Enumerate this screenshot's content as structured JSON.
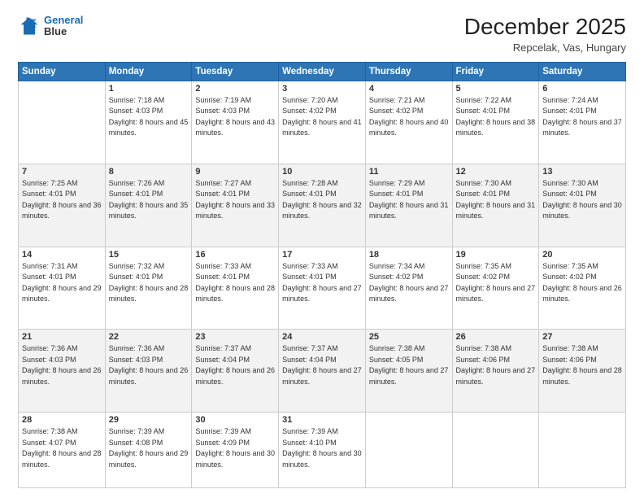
{
  "logo": {
    "line1": "General",
    "line2": "Blue"
  },
  "header": {
    "month": "December 2025",
    "location": "Repcelak, Vas, Hungary"
  },
  "weekdays": [
    "Sunday",
    "Monday",
    "Tuesday",
    "Wednesday",
    "Thursday",
    "Friday",
    "Saturday"
  ],
  "weeks": [
    [
      {
        "day": "",
        "sunrise": "",
        "sunset": "",
        "daylight": ""
      },
      {
        "day": "1",
        "sunrise": "Sunrise: 7:18 AM",
        "sunset": "Sunset: 4:03 PM",
        "daylight": "Daylight: 8 hours and 45 minutes."
      },
      {
        "day": "2",
        "sunrise": "Sunrise: 7:19 AM",
        "sunset": "Sunset: 4:03 PM",
        "daylight": "Daylight: 8 hours and 43 minutes."
      },
      {
        "day": "3",
        "sunrise": "Sunrise: 7:20 AM",
        "sunset": "Sunset: 4:02 PM",
        "daylight": "Daylight: 8 hours and 41 minutes."
      },
      {
        "day": "4",
        "sunrise": "Sunrise: 7:21 AM",
        "sunset": "Sunset: 4:02 PM",
        "daylight": "Daylight: 8 hours and 40 minutes."
      },
      {
        "day": "5",
        "sunrise": "Sunrise: 7:22 AM",
        "sunset": "Sunset: 4:01 PM",
        "daylight": "Daylight: 8 hours and 38 minutes."
      },
      {
        "day": "6",
        "sunrise": "Sunrise: 7:24 AM",
        "sunset": "Sunset: 4:01 PM",
        "daylight": "Daylight: 8 hours and 37 minutes."
      }
    ],
    [
      {
        "day": "7",
        "sunrise": "Sunrise: 7:25 AM",
        "sunset": "Sunset: 4:01 PM",
        "daylight": "Daylight: 8 hours and 36 minutes."
      },
      {
        "day": "8",
        "sunrise": "Sunrise: 7:26 AM",
        "sunset": "Sunset: 4:01 PM",
        "daylight": "Daylight: 8 hours and 35 minutes."
      },
      {
        "day": "9",
        "sunrise": "Sunrise: 7:27 AM",
        "sunset": "Sunset: 4:01 PM",
        "daylight": "Daylight: 8 hours and 33 minutes."
      },
      {
        "day": "10",
        "sunrise": "Sunrise: 7:28 AM",
        "sunset": "Sunset: 4:01 PM",
        "daylight": "Daylight: 8 hours and 32 minutes."
      },
      {
        "day": "11",
        "sunrise": "Sunrise: 7:29 AM",
        "sunset": "Sunset: 4:01 PM",
        "daylight": "Daylight: 8 hours and 31 minutes."
      },
      {
        "day": "12",
        "sunrise": "Sunrise: 7:30 AM",
        "sunset": "Sunset: 4:01 PM",
        "daylight": "Daylight: 8 hours and 31 minutes."
      },
      {
        "day": "13",
        "sunrise": "Sunrise: 7:30 AM",
        "sunset": "Sunset: 4:01 PM",
        "daylight": "Daylight: 8 hours and 30 minutes."
      }
    ],
    [
      {
        "day": "14",
        "sunrise": "Sunrise: 7:31 AM",
        "sunset": "Sunset: 4:01 PM",
        "daylight": "Daylight: 8 hours and 29 minutes."
      },
      {
        "day": "15",
        "sunrise": "Sunrise: 7:32 AM",
        "sunset": "Sunset: 4:01 PM",
        "daylight": "Daylight: 8 hours and 28 minutes."
      },
      {
        "day": "16",
        "sunrise": "Sunrise: 7:33 AM",
        "sunset": "Sunset: 4:01 PM",
        "daylight": "Daylight: 8 hours and 28 minutes."
      },
      {
        "day": "17",
        "sunrise": "Sunrise: 7:33 AM",
        "sunset": "Sunset: 4:01 PM",
        "daylight": "Daylight: 8 hours and 27 minutes."
      },
      {
        "day": "18",
        "sunrise": "Sunrise: 7:34 AM",
        "sunset": "Sunset: 4:02 PM",
        "daylight": "Daylight: 8 hours and 27 minutes."
      },
      {
        "day": "19",
        "sunrise": "Sunrise: 7:35 AM",
        "sunset": "Sunset: 4:02 PM",
        "daylight": "Daylight: 8 hours and 27 minutes."
      },
      {
        "day": "20",
        "sunrise": "Sunrise: 7:35 AM",
        "sunset": "Sunset: 4:02 PM",
        "daylight": "Daylight: 8 hours and 26 minutes."
      }
    ],
    [
      {
        "day": "21",
        "sunrise": "Sunrise: 7:36 AM",
        "sunset": "Sunset: 4:03 PM",
        "daylight": "Daylight: 8 hours and 26 minutes."
      },
      {
        "day": "22",
        "sunrise": "Sunrise: 7:36 AM",
        "sunset": "Sunset: 4:03 PM",
        "daylight": "Daylight: 8 hours and 26 minutes."
      },
      {
        "day": "23",
        "sunrise": "Sunrise: 7:37 AM",
        "sunset": "Sunset: 4:04 PM",
        "daylight": "Daylight: 8 hours and 26 minutes."
      },
      {
        "day": "24",
        "sunrise": "Sunrise: 7:37 AM",
        "sunset": "Sunset: 4:04 PM",
        "daylight": "Daylight: 8 hours and 27 minutes."
      },
      {
        "day": "25",
        "sunrise": "Sunrise: 7:38 AM",
        "sunset": "Sunset: 4:05 PM",
        "daylight": "Daylight: 8 hours and 27 minutes."
      },
      {
        "day": "26",
        "sunrise": "Sunrise: 7:38 AM",
        "sunset": "Sunset: 4:06 PM",
        "daylight": "Daylight: 8 hours and 27 minutes."
      },
      {
        "day": "27",
        "sunrise": "Sunrise: 7:38 AM",
        "sunset": "Sunset: 4:06 PM",
        "daylight": "Daylight: 8 hours and 28 minutes."
      }
    ],
    [
      {
        "day": "28",
        "sunrise": "Sunrise: 7:38 AM",
        "sunset": "Sunset: 4:07 PM",
        "daylight": "Daylight: 8 hours and 28 minutes."
      },
      {
        "day": "29",
        "sunrise": "Sunrise: 7:39 AM",
        "sunset": "Sunset: 4:08 PM",
        "daylight": "Daylight: 8 hours and 29 minutes."
      },
      {
        "day": "30",
        "sunrise": "Sunrise: 7:39 AM",
        "sunset": "Sunset: 4:09 PM",
        "daylight": "Daylight: 8 hours and 30 minutes."
      },
      {
        "day": "31",
        "sunrise": "Sunrise: 7:39 AM",
        "sunset": "Sunset: 4:10 PM",
        "daylight": "Daylight: 8 hours and 30 minutes."
      },
      {
        "day": "",
        "sunrise": "",
        "sunset": "",
        "daylight": ""
      },
      {
        "day": "",
        "sunrise": "",
        "sunset": "",
        "daylight": ""
      },
      {
        "day": "",
        "sunrise": "",
        "sunset": "",
        "daylight": ""
      }
    ]
  ]
}
